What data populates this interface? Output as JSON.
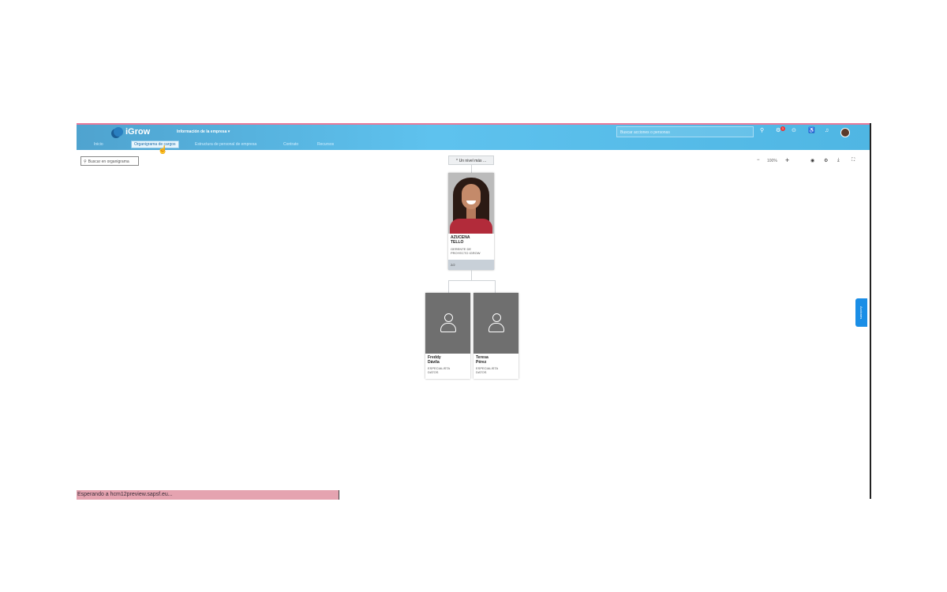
{
  "header": {
    "logo_text": "iGrow",
    "module_menu": "Información de la empresa",
    "search_placeholder": "Buscar acciones o personas",
    "notification_count": "1",
    "icons": [
      "search-icon",
      "notifications-icon",
      "help-icon",
      "access-icon",
      "bell-icon",
      "user-avatar"
    ]
  },
  "tabs": [
    {
      "label": "Inicio",
      "active": false
    },
    {
      "label": "Organigrama de cargos",
      "active": true
    },
    {
      "label": "Estructura de personal de empresa",
      "active": false
    },
    {
      "label": "Contrato",
      "active": false
    },
    {
      "label": "Recursos",
      "active": false
    }
  ],
  "toolbar": {
    "org_search_placeholder": "Buscar en organigrama",
    "zoom_level": "100%",
    "zoom_out": "−",
    "zoom_in": "+"
  },
  "org_chart": {
    "up_level_label": "Un nivel más ...",
    "root": {
      "name": "AZUCENA\nTELLO",
      "title": "GERENTE DE\nPROYECTO IGROW",
      "footer": "2/2"
    },
    "children": [
      {
        "name": "Freddy\nDávila",
        "title": "ESPECIALISTA\nDATOS"
      },
      {
        "name": "Teresa\nPérez",
        "title": "ESPECIALISTA\nDATOS"
      }
    ]
  },
  "side_tab": "Acciones",
  "status_bar": "Esperando a hcm12preview.sapsf.eu..."
}
